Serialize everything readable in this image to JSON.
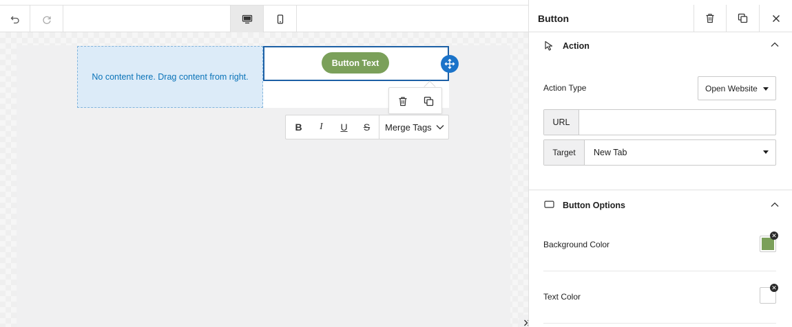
{
  "canvas": {
    "placeholder_text": "No content here. Drag content from right.",
    "button_text": "Button Text",
    "button_color": "#7ba05a",
    "selection_color": "#1b5fa5"
  },
  "toolbar": {
    "icons": [
      "undo-icon",
      "redo-icon",
      "desktop-icon",
      "mobile-icon"
    ]
  },
  "format_bar": {
    "bold_glyph": "B",
    "italic_glyph": "I",
    "underline_glyph": "U",
    "strike_glyph": "S",
    "merge_tags_label": "Merge Tags"
  },
  "panel": {
    "title": "Button",
    "action_section": {
      "title": "Action",
      "action_type_label": "Action Type",
      "action_type_value": "Open Website",
      "url_label": "URL",
      "url_value": "",
      "target_label": "Target",
      "target_value": "New Tab"
    },
    "options_section": {
      "title": "Button Options",
      "background_color_label": "Background Color",
      "background_color_value": "#7ba05a",
      "text_color_label": "Text Color",
      "text_color_value": "#ffffff"
    }
  }
}
